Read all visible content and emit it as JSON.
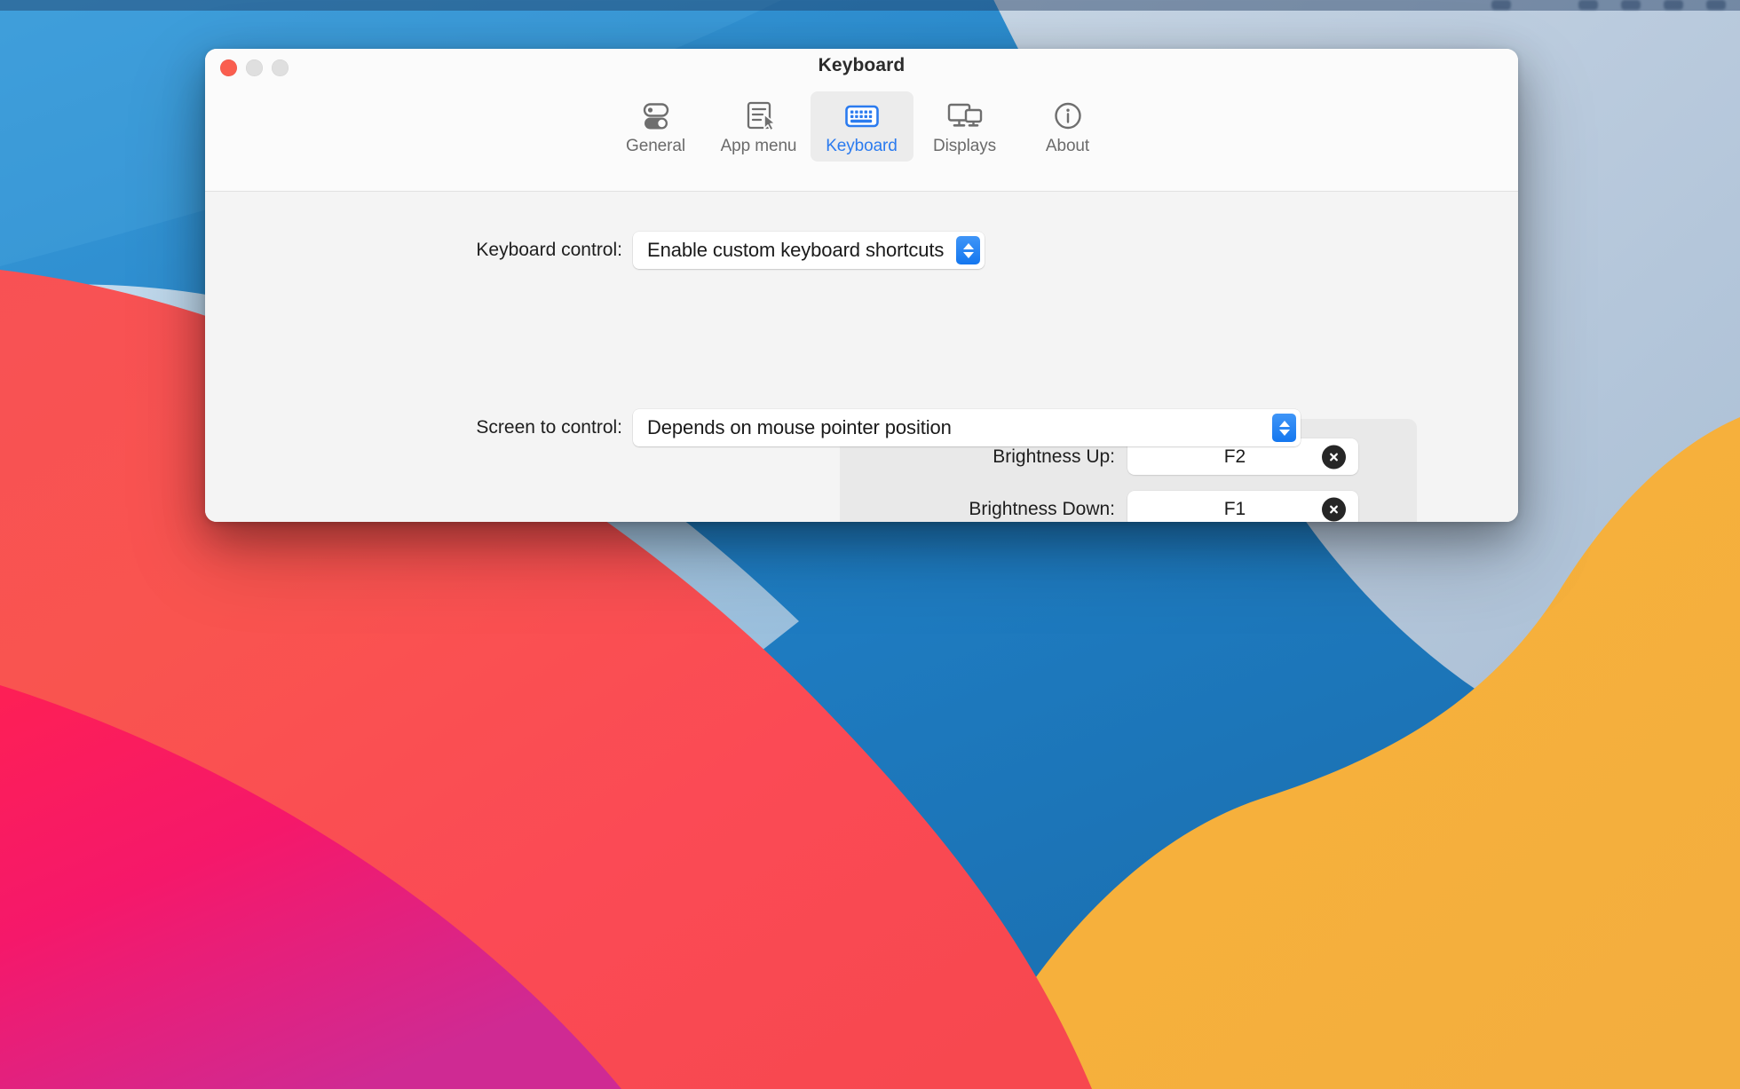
{
  "window": {
    "title": "Keyboard",
    "traffic_lights": [
      {
        "name": "close",
        "color": "#fa5e4f"
      },
      {
        "name": "minimize",
        "color": "#dfdfdf"
      },
      {
        "name": "zoom",
        "color": "#dfdfdf"
      }
    ]
  },
  "toolbar": {
    "tabs": [
      {
        "id": "general",
        "label": "General",
        "icon": "toggles-icon",
        "selected": false
      },
      {
        "id": "app-menu",
        "label": "App menu",
        "icon": "document-cursor-icon",
        "selected": false
      },
      {
        "id": "keyboard",
        "label": "Keyboard",
        "icon": "keyboard-icon",
        "selected": true
      },
      {
        "id": "displays",
        "label": "Displays",
        "icon": "displays-icon",
        "selected": false
      },
      {
        "id": "about",
        "label": "About",
        "icon": "info-circle-icon",
        "selected": false
      }
    ],
    "selected_tab": "Keyboard"
  },
  "content": {
    "keyboard_control": {
      "label": "Keyboard control:",
      "value": "Enable custom keyboard shortcuts"
    },
    "shortcuts": [
      {
        "label": "Brightness Up:",
        "value": "F2",
        "clear": "clear-icon"
      },
      {
        "label": "Brightness Down:",
        "value": "F1",
        "clear": "clear-icon"
      }
    ],
    "screen_to_control": {
      "label": "Screen to control:",
      "value": "Depends on mouse pointer position"
    }
  },
  "colors": {
    "accent_blue": "#1477ef",
    "selected_tab_text": "#2b7bef",
    "close_red": "#fa5e4f",
    "group_bg": "#e9e9e9",
    "content_bg": "#f4f4f4"
  }
}
